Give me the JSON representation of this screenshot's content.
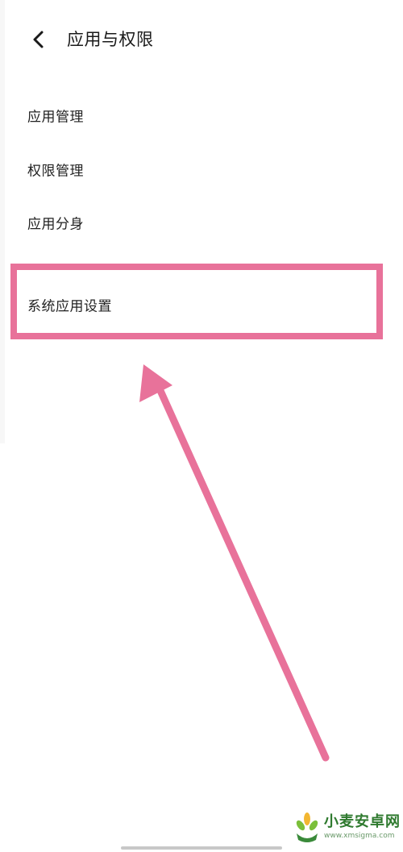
{
  "header": {
    "title": "应用与权限",
    "back_icon": "chevron-left-icon"
  },
  "menu": {
    "items": [
      {
        "label": "应用管理"
      },
      {
        "label": "权限管理"
      },
      {
        "label": "应用分身"
      },
      {
        "label": "系统应用设置"
      }
    ]
  },
  "annotation": {
    "color": "#e8729a"
  },
  "watermark": {
    "title": "小麦安卓网",
    "url": "www.xmsigma.com"
  }
}
